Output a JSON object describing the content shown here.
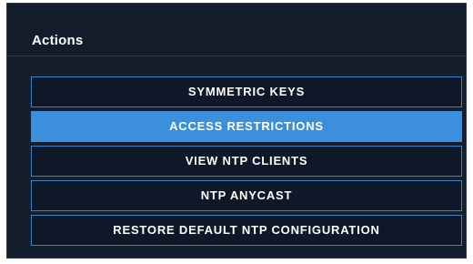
{
  "panel": {
    "title": "Actions",
    "accent_color": "#3b8fdb",
    "background_color": "#141e2c"
  },
  "actions": [
    {
      "label": "SYMMETRIC KEYS",
      "active": false
    },
    {
      "label": "ACCESS RESTRICTIONS",
      "active": true
    },
    {
      "label": "VIEW NTP CLIENTS",
      "active": false
    },
    {
      "label": "NTP ANYCAST",
      "active": false
    },
    {
      "label": "RESTORE DEFAULT NTP CONFIGURATION",
      "active": false
    }
  ]
}
